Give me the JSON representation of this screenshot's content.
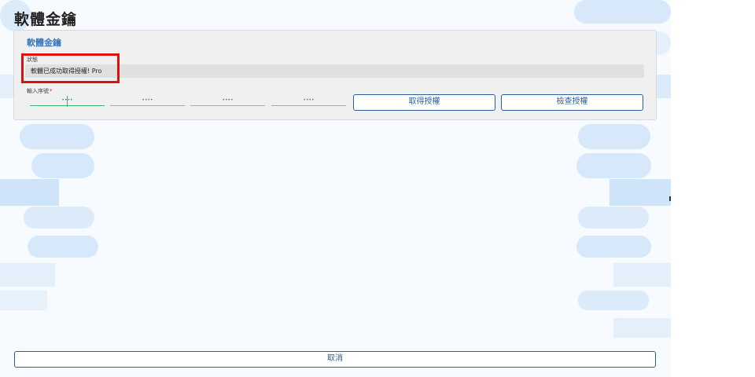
{
  "page": {
    "title": "軟體金鑰"
  },
  "card": {
    "title": "軟體金鑰",
    "status_label": "狀態",
    "status_value": "軟體已成功取得授權! Pro",
    "serial_label": "輸入序號",
    "required_mark": "*",
    "serial_fields": [
      {
        "placeholder": "••••",
        "active": true
      },
      {
        "placeholder": "••••",
        "active": false
      },
      {
        "placeholder": "••••",
        "active": false
      },
      {
        "placeholder": "••••",
        "active": false
      }
    ],
    "get_license_label": "取得授權",
    "check_license_label": "檢查授權"
  },
  "footer": {
    "cancel_label": "取消"
  },
  "colors": {
    "accent": "#2a5d9a",
    "title_blue": "#3a78b8",
    "highlight": "#e01010",
    "active_underline": "#3cb371"
  }
}
